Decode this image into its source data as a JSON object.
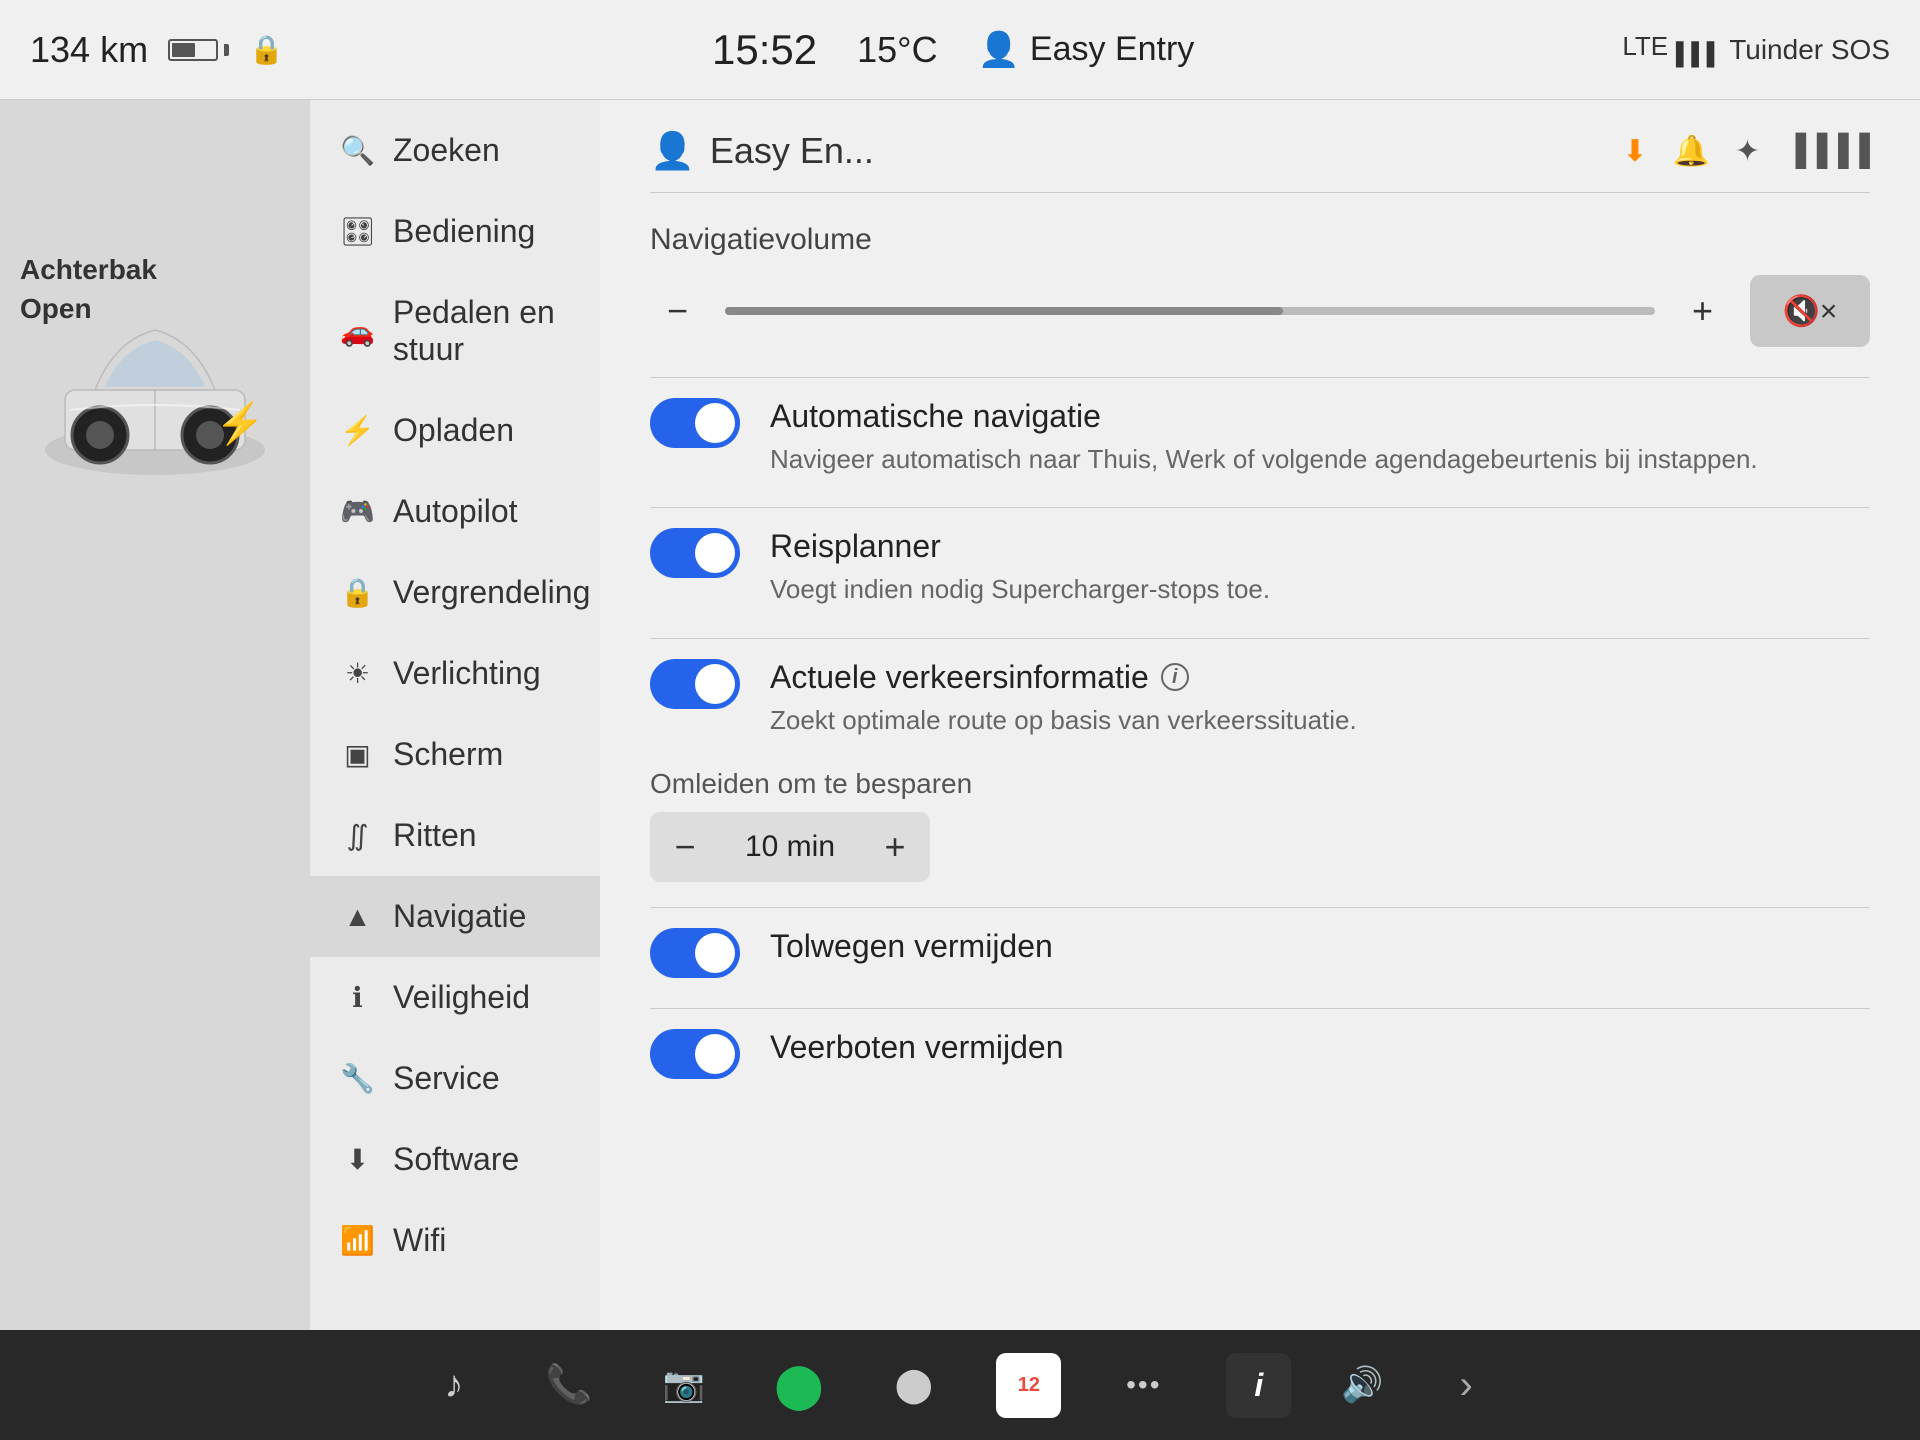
{
  "statusBar": {
    "km": "134 km",
    "time": "15:52",
    "temp": "15°C",
    "easyEntry": "Easy Entry",
    "lte": "LTE",
    "tuinder": "Tuinder",
    "sos": "SOS"
  },
  "carPanel": {
    "statusLine1": "Achterbak",
    "statusLine2": "Open"
  },
  "sidebar": {
    "items": [
      {
        "id": "zoeken",
        "icon": "🔍",
        "label": "Zoeken"
      },
      {
        "id": "bediening",
        "icon": "🎛",
        "label": "Bediening"
      },
      {
        "id": "pedalen",
        "icon": "🚗",
        "label": "Pedalen en stuur"
      },
      {
        "id": "opladen",
        "icon": "⚡",
        "label": "Opladen"
      },
      {
        "id": "autopilot",
        "icon": "🎮",
        "label": "Autopilot"
      },
      {
        "id": "vergrendeling",
        "icon": "🔒",
        "label": "Vergrendeling"
      },
      {
        "id": "verlichting",
        "icon": "☀",
        "label": "Verlichting"
      },
      {
        "id": "scherm",
        "icon": "📺",
        "label": "Scherm"
      },
      {
        "id": "ritten",
        "icon": "📊",
        "label": "Ritten"
      },
      {
        "id": "navigatie",
        "icon": "▲",
        "label": "Navigatie",
        "active": true
      },
      {
        "id": "veiligheid",
        "icon": "ℹ",
        "label": "Veiligheid"
      },
      {
        "id": "service",
        "icon": "🔧",
        "label": "Service"
      },
      {
        "id": "software",
        "icon": "⬇",
        "label": "Software"
      },
      {
        "id": "wifi",
        "icon": "📶",
        "label": "Wifi"
      }
    ]
  },
  "content": {
    "profileTitle": "Easy En...",
    "icons": {
      "download": "⬇",
      "bell": "🔔",
      "bluetooth": "🔵",
      "signal": "📶"
    },
    "navigationVolume": {
      "label": "Navigatievolume",
      "minusLabel": "−",
      "plusLabel": "+",
      "muteLabel": "🔇×"
    },
    "toggles": [
      {
        "id": "auto-nav",
        "title": "Automatische navigatie",
        "description": "Navigeer automatisch naar Thuis, Werk of volgende agendagebeurtenis bij instappen.",
        "on": true
      },
      {
        "id": "reisplanner",
        "title": "Reisplanner",
        "description": "Voegt indien nodig Supercharger-stops toe.",
        "on": true
      },
      {
        "id": "verkeer",
        "title": "Actuele verkeersinformatie",
        "description": "Zoekt optimale route op basis van verkeerssituatie.",
        "on": true,
        "hasInfo": true
      }
    ],
    "stepper": {
      "label": "Omleiden om te besparen",
      "value": "10 min",
      "minus": "−",
      "plus": "+"
    },
    "togglesBottom": [
      {
        "id": "tolwegen",
        "title": "Tolwegen vermijden",
        "on": true
      },
      {
        "id": "veerboten",
        "title": "Veerboten vermijden",
        "on": true
      }
    ]
  },
  "taskbar": {
    "icons": [
      {
        "id": "music",
        "symbol": "♪",
        "label": "music-note"
      },
      {
        "id": "phone",
        "symbol": "📞",
        "label": "phone",
        "green": true
      },
      {
        "id": "camera",
        "symbol": "📷",
        "label": "camera"
      },
      {
        "id": "spotify",
        "symbol": "●",
        "label": "spotify"
      },
      {
        "id": "dash",
        "symbol": "⬤",
        "label": "dash-cam"
      },
      {
        "id": "calendar",
        "symbol": "12",
        "label": "calendar"
      },
      {
        "id": "more",
        "symbol": "•••",
        "label": "more"
      },
      {
        "id": "info",
        "symbol": "i",
        "label": "info"
      }
    ],
    "volumeIcon": "🔊",
    "arrowRight": "›"
  }
}
